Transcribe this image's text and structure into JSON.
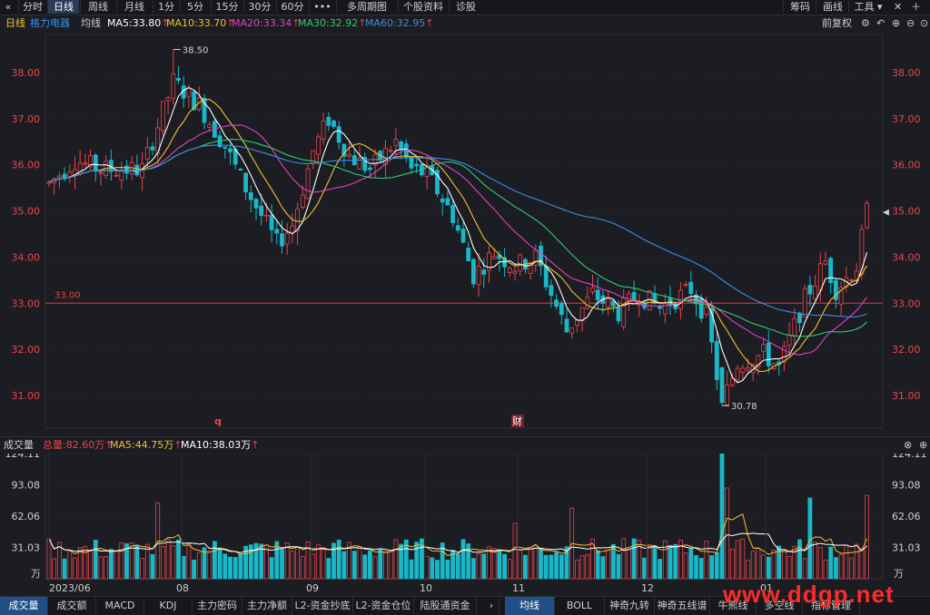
{
  "toolbar": {
    "back_icon": "«",
    "tabs": [
      "分时",
      "日线",
      "周线",
      "月线",
      "1分",
      "5分",
      "15分",
      "30分",
      "60分",
      "•••",
      "多周期图",
      "个股资料",
      "诊股"
    ],
    "active_tab": "日线",
    "right_items": [
      "筹码",
      "画线",
      "工具"
    ]
  },
  "info": {
    "period": "日线",
    "stock_name": "格力电器",
    "ma_label": "均线",
    "ma5": "MA5:33.80",
    "ma10": "MA10:33.70",
    "ma20": "MA20:33.34",
    "ma30": "MA30:32.92",
    "ma60": "MA60:32.95",
    "adjust": "前复权"
  },
  "colors": {
    "up": "#e8454e",
    "down": "#19b8c8",
    "ma5": "#ffffff",
    "ma10": "#f2c12e",
    "ma20": "#e040c8",
    "ma30": "#2ecc71",
    "ma60": "#3a8ee6",
    "axis_text": "#e8454e"
  },
  "price_axis": {
    "labels": [
      "38.00",
      "37.00",
      "36.00",
      "35.00",
      "34.00",
      "33.00",
      "32.00",
      "31.00"
    ],
    "high_label": "38.50",
    "low_label": "30.78",
    "ref_line_label": "33.00",
    "ref_line_value": 33.0
  },
  "date_labels": [
    "2023/06",
    "08",
    "09",
    "10",
    "11",
    "12",
    "01"
  ],
  "markers": [
    "q",
    "财"
  ],
  "volume": {
    "title": "成交量",
    "total": "总量:82.60万",
    "ma5": "MA5:44.75万",
    "ma10": "MA10:38.03万",
    "axis_labels": [
      "124.11",
      "93.08",
      "62.06",
      "31.03"
    ],
    "unit": "万"
  },
  "bottom_tabs_left": [
    "成交量",
    "成交额",
    "MACD",
    "KDJ",
    "主力密码",
    "主力净额",
    "L2-资金抄底",
    "L2-资金仓位",
    "陆股通资金"
  ],
  "bottom_tabs_right": [
    "均线",
    "BOLL",
    "神奇九转",
    "神奇五线谱",
    "牛熊线",
    "多空线",
    "指标管理"
  ],
  "watermark": "www.ddgp.net",
  "chart_data": {
    "type": "candlestick",
    "anchors": [
      [
        0,
        35.6
      ],
      [
        5,
        36.1
      ],
      [
        10,
        35.9
      ],
      [
        18,
        35.9
      ],
      [
        24,
        37.8
      ],
      [
        29,
        37.3
      ],
      [
        34,
        36.4
      ],
      [
        38,
        35.5
      ],
      [
        44,
        34.3
      ],
      [
        47,
        34.7
      ],
      [
        51,
        36.3
      ],
      [
        54,
        37.0
      ],
      [
        58,
        36.2
      ],
      [
        62,
        35.9
      ],
      [
        67,
        36.5
      ],
      [
        70,
        35.9
      ],
      [
        73,
        35.8
      ],
      [
        78,
        34.9
      ],
      [
        82,
        33.6
      ],
      [
        86,
        34.1
      ],
      [
        90,
        33.8
      ],
      [
        94,
        34.0
      ],
      [
        100,
        32.4
      ],
      [
        105,
        33.2
      ],
      [
        110,
        32.8
      ],
      [
        114,
        33.2
      ],
      [
        118,
        32.9
      ],
      [
        124,
        33.3
      ],
      [
        127,
        32.7
      ],
      [
        130,
        30.8
      ],
      [
        133,
        31.7
      ],
      [
        138,
        31.9
      ],
      [
        141,
        31.6
      ],
      [
        146,
        33.1
      ],
      [
        150,
        33.9
      ],
      [
        152,
        33.3
      ],
      [
        156,
        33.8
      ],
      [
        158,
        35.0
      ]
    ],
    "ylim": [
      30.5,
      38.9
    ]
  }
}
